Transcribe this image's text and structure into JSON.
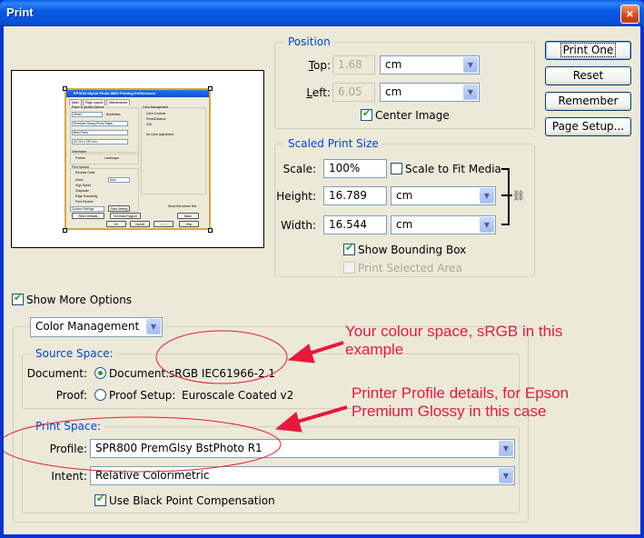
{
  "window": {
    "title": "Print",
    "close_icon": "×"
  },
  "preview": {
    "thumbnail": {
      "title": "EPSON Stylus Photo 8800 Printing Preferences",
      "tabs": [
        "Main",
        "Page Layout",
        "Maintenance"
      ],
      "paper_quality_label": "Paper & Quality Options",
      "source": "Sheet",
      "borderless": "Borderless",
      "media": "Premium Glossy Photo Paper",
      "quality": "Best Photo",
      "size": "A4 210 x 297 mm",
      "orientation_label": "Orientation",
      "portrait": "Portrait",
      "landscape": "Landscape",
      "print_options_label": "Print Options",
      "options": [
        "Reverse Order",
        "Gloss",
        "High Speed",
        "Grayscale",
        "Edge Smoothing",
        "Print Preview"
      ],
      "gloss_value": "Auto",
      "color_mgmt_label": "Color Management",
      "color_options": [
        "Color Controls",
        "PhotoEnhance",
        "ICM"
      ],
      "no_color_adj": "No Color Adjustment",
      "custom_settings": "Custom Settings",
      "save_setting": "Save Setting",
      "reset_defaults": "Reset Defaults",
      "technical_support": "Technical Support",
      "show_screen_first": "Show this screen first",
      "basic": "Basic",
      "ok": "OK",
      "cancel": "Cancel",
      "apply": "Apply",
      "help": "Help"
    }
  },
  "position": {
    "legend": "Position",
    "top_label": "Top:",
    "top_value": "1.68",
    "top_unit": "cm",
    "left_label": "Left:",
    "left_value": "6.05",
    "left_unit": "cm",
    "center_image_label": "Center Image",
    "center_image_checked": true
  },
  "scaled_print_size": {
    "legend": "Scaled Print Size",
    "scale_label": "Scale:",
    "scale_value": "100%",
    "scale_to_fit_label": "Scale to Fit Media",
    "scale_to_fit_checked": false,
    "height_label": "Height:",
    "height_value": "16.789",
    "height_unit": "cm",
    "width_label": "Width:",
    "width_value": "16.544",
    "width_unit": "cm",
    "link_icon": "chain-link",
    "show_bounding_box_label": "Show Bounding Box",
    "show_bounding_box_checked": true,
    "print_selected_area_label": "Print Selected Area",
    "print_selected_area_checked": false
  },
  "buttons": {
    "print_one": "Print One",
    "reset": "Reset",
    "remember": "Remember",
    "page_setup": "Page Setup..."
  },
  "more_options": {
    "label": "Show More Options",
    "checked": true,
    "section_select": "Color Management"
  },
  "source_space": {
    "legend": "Source Space:",
    "document_label": "Document:",
    "document_radio_label": "Document:",
    "document_profile": "sRGB IEC61966-2.1",
    "document_selected": true,
    "proof_label": "Proof:",
    "proof_radio_label": "Proof Setup:",
    "proof_profile": "Euroscale Coated v2",
    "proof_selected": false
  },
  "print_space": {
    "legend": "Print Space:",
    "profile_label": "Profile:",
    "profile_value": "SPR800 PremGlsy BstPhoto R1",
    "intent_label": "Intent:",
    "intent_value": "Relative Colorimetric",
    "black_point_label": "Use Black Point Compensation",
    "black_point_checked": true
  },
  "annotations": {
    "colour_space_line1": "Your colour space, sRGB in this",
    "colour_space_line2": "example",
    "printer_profile_line1": "Printer Profile details, for Epson",
    "printer_profile_line2": "Premium Glossy in this case",
    "color": "#e8183e"
  }
}
